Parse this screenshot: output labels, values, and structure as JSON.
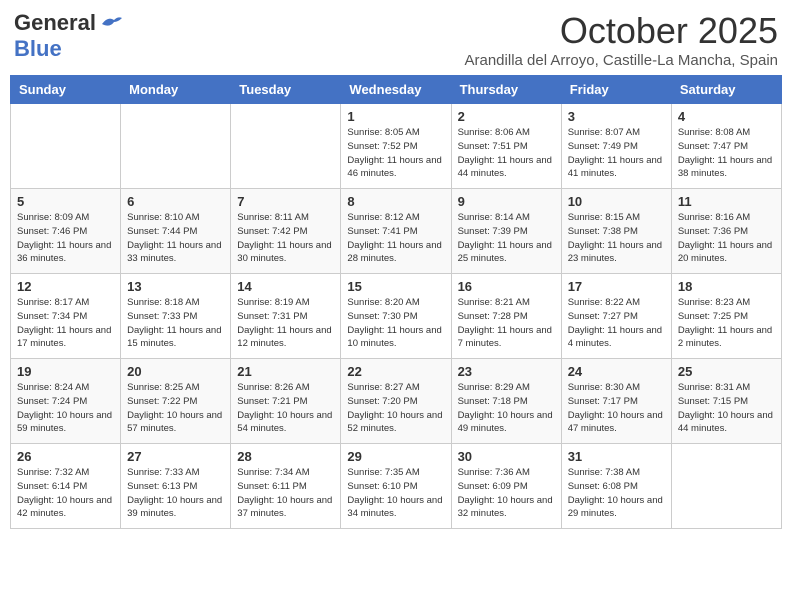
{
  "header": {
    "logo_general": "General",
    "logo_blue": "Blue",
    "month": "October 2025",
    "location": "Arandilla del Arroyo, Castille-La Mancha, Spain"
  },
  "weekdays": [
    "Sunday",
    "Monday",
    "Tuesday",
    "Wednesday",
    "Thursday",
    "Friday",
    "Saturday"
  ],
  "weeks": [
    [
      {
        "day": "",
        "info": ""
      },
      {
        "day": "",
        "info": ""
      },
      {
        "day": "",
        "info": ""
      },
      {
        "day": "1",
        "info": "Sunrise: 8:05 AM\nSunset: 7:52 PM\nDaylight: 11 hours and 46 minutes."
      },
      {
        "day": "2",
        "info": "Sunrise: 8:06 AM\nSunset: 7:51 PM\nDaylight: 11 hours and 44 minutes."
      },
      {
        "day": "3",
        "info": "Sunrise: 8:07 AM\nSunset: 7:49 PM\nDaylight: 11 hours and 41 minutes."
      },
      {
        "day": "4",
        "info": "Sunrise: 8:08 AM\nSunset: 7:47 PM\nDaylight: 11 hours and 38 minutes."
      }
    ],
    [
      {
        "day": "5",
        "info": "Sunrise: 8:09 AM\nSunset: 7:46 PM\nDaylight: 11 hours and 36 minutes."
      },
      {
        "day": "6",
        "info": "Sunrise: 8:10 AM\nSunset: 7:44 PM\nDaylight: 11 hours and 33 minutes."
      },
      {
        "day": "7",
        "info": "Sunrise: 8:11 AM\nSunset: 7:42 PM\nDaylight: 11 hours and 30 minutes."
      },
      {
        "day": "8",
        "info": "Sunrise: 8:12 AM\nSunset: 7:41 PM\nDaylight: 11 hours and 28 minutes."
      },
      {
        "day": "9",
        "info": "Sunrise: 8:14 AM\nSunset: 7:39 PM\nDaylight: 11 hours and 25 minutes."
      },
      {
        "day": "10",
        "info": "Sunrise: 8:15 AM\nSunset: 7:38 PM\nDaylight: 11 hours and 23 minutes."
      },
      {
        "day": "11",
        "info": "Sunrise: 8:16 AM\nSunset: 7:36 PM\nDaylight: 11 hours and 20 minutes."
      }
    ],
    [
      {
        "day": "12",
        "info": "Sunrise: 8:17 AM\nSunset: 7:34 PM\nDaylight: 11 hours and 17 minutes."
      },
      {
        "day": "13",
        "info": "Sunrise: 8:18 AM\nSunset: 7:33 PM\nDaylight: 11 hours and 15 minutes."
      },
      {
        "day": "14",
        "info": "Sunrise: 8:19 AM\nSunset: 7:31 PM\nDaylight: 11 hours and 12 minutes."
      },
      {
        "day": "15",
        "info": "Sunrise: 8:20 AM\nSunset: 7:30 PM\nDaylight: 11 hours and 10 minutes."
      },
      {
        "day": "16",
        "info": "Sunrise: 8:21 AM\nSunset: 7:28 PM\nDaylight: 11 hours and 7 minutes."
      },
      {
        "day": "17",
        "info": "Sunrise: 8:22 AM\nSunset: 7:27 PM\nDaylight: 11 hours and 4 minutes."
      },
      {
        "day": "18",
        "info": "Sunrise: 8:23 AM\nSunset: 7:25 PM\nDaylight: 11 hours and 2 minutes."
      }
    ],
    [
      {
        "day": "19",
        "info": "Sunrise: 8:24 AM\nSunset: 7:24 PM\nDaylight: 10 hours and 59 minutes."
      },
      {
        "day": "20",
        "info": "Sunrise: 8:25 AM\nSunset: 7:22 PM\nDaylight: 10 hours and 57 minutes."
      },
      {
        "day": "21",
        "info": "Sunrise: 8:26 AM\nSunset: 7:21 PM\nDaylight: 10 hours and 54 minutes."
      },
      {
        "day": "22",
        "info": "Sunrise: 8:27 AM\nSunset: 7:20 PM\nDaylight: 10 hours and 52 minutes."
      },
      {
        "day": "23",
        "info": "Sunrise: 8:29 AM\nSunset: 7:18 PM\nDaylight: 10 hours and 49 minutes."
      },
      {
        "day": "24",
        "info": "Sunrise: 8:30 AM\nSunset: 7:17 PM\nDaylight: 10 hours and 47 minutes."
      },
      {
        "day": "25",
        "info": "Sunrise: 8:31 AM\nSunset: 7:15 PM\nDaylight: 10 hours and 44 minutes."
      }
    ],
    [
      {
        "day": "26",
        "info": "Sunrise: 7:32 AM\nSunset: 6:14 PM\nDaylight: 10 hours and 42 minutes."
      },
      {
        "day": "27",
        "info": "Sunrise: 7:33 AM\nSunset: 6:13 PM\nDaylight: 10 hours and 39 minutes."
      },
      {
        "day": "28",
        "info": "Sunrise: 7:34 AM\nSunset: 6:11 PM\nDaylight: 10 hours and 37 minutes."
      },
      {
        "day": "29",
        "info": "Sunrise: 7:35 AM\nSunset: 6:10 PM\nDaylight: 10 hours and 34 minutes."
      },
      {
        "day": "30",
        "info": "Sunrise: 7:36 AM\nSunset: 6:09 PM\nDaylight: 10 hours and 32 minutes."
      },
      {
        "day": "31",
        "info": "Sunrise: 7:38 AM\nSunset: 6:08 PM\nDaylight: 10 hours and 29 minutes."
      },
      {
        "day": "",
        "info": ""
      }
    ]
  ]
}
